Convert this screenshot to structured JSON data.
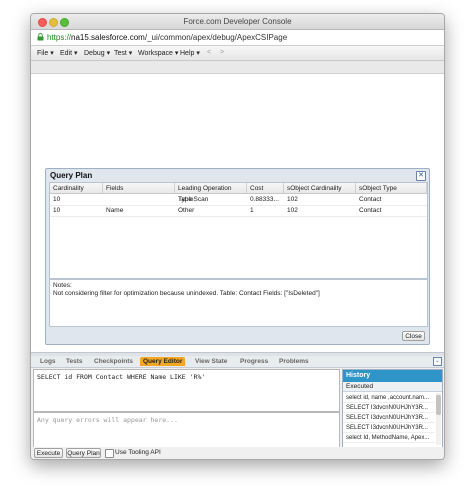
{
  "window": {
    "title": "Force.com Developer Console"
  },
  "urlbar": {
    "scheme": "https://",
    "host": "na15.salesforce.com",
    "path": "/_ui/common/apex/debug/ApexCSIPage"
  },
  "menu": [
    "File",
    "Edit",
    "Debug",
    "Test",
    "Workspace",
    "Help",
    "<",
    ">"
  ],
  "query_plan": {
    "title": "Query Plan",
    "columns": [
      "Cardinality",
      "Fields",
      "Leading Operation Type",
      "Cost",
      "sObject Cardinality",
      "sObject Type"
    ],
    "rows": [
      [
        "10",
        "",
        "TableScan",
        "0.88333...",
        "102",
        "Contact"
      ],
      [
        "10",
        "Name",
        "Other",
        "1",
        "102",
        "Contact"
      ]
    ],
    "notes_title": "Notes:",
    "notes_text": "Not considering filter for optimization because unindexed. Table: Contact Fields: [\"IsDeleted\"]",
    "close_label": "Close"
  },
  "tabs": [
    "Logs",
    "Tests",
    "Checkpoints",
    "Query Editor",
    "View State",
    "Progress",
    "Problems"
  ],
  "active_tab": "Query Editor",
  "editor": {
    "query": "SELECT id FROM Contact WHERE Name LIKE 'R%'",
    "errors_placeholder": "Any query errors will appear here..."
  },
  "history": {
    "title": "History",
    "subtitle": "Executed",
    "items": [
      "select id, name ,account.nam...",
      "SELECT I3dvcnN0UHJhY3R...",
      "SELECT I3dvcnN0UHJhY3R...",
      "SELECT I3dvcnN0UHJhY3R...",
      "select Id, MethodName, Apex..."
    ]
  },
  "footer": {
    "execute_label": "Execute",
    "query_plan_label": "Query Plan",
    "tooling_label": "Use Tooling API"
  },
  "colors": {
    "active_tab": "#f5a623",
    "history_header": "#2f95c8"
  }
}
